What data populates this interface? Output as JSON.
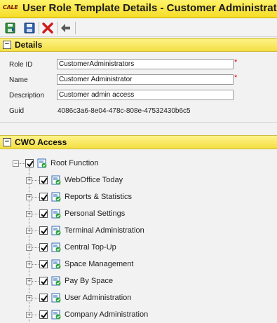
{
  "window": {
    "logo_text": "CALE",
    "title": "User Role Template Details - Customer Administrator"
  },
  "toolbar": {
    "buttons": [
      {
        "name": "save-close",
        "icon": "save-close-icon"
      },
      {
        "name": "save",
        "icon": "floppy-disk-icon"
      },
      {
        "name": "delete",
        "icon": "red-x-icon"
      },
      {
        "name": "back",
        "icon": "back-arrow-icon"
      }
    ]
  },
  "details": {
    "title": "Details",
    "collapse_symbol": "−",
    "fields": {
      "role_id": {
        "label": "Role ID",
        "value": "CustomerAdministrators",
        "required": "*"
      },
      "name": {
        "label": "Name",
        "value": "Customer Administrator",
        "required": "*"
      },
      "description": {
        "label": "Description",
        "value": "Customer admin access"
      },
      "guid": {
        "label": "Guid",
        "value": "4086c3a6-8e04-478c-808e-47532430b6c5"
      }
    }
  },
  "cwo_access": {
    "title": "CWO Access",
    "collapse_symbol": "−",
    "root": {
      "label": "Root Function",
      "checked": true,
      "expanded": true,
      "expander": "−"
    },
    "children": [
      {
        "label": "WebOffice Today",
        "checked": true,
        "expander": "+"
      },
      {
        "label": "Reports & Statistics",
        "checked": true,
        "expander": "+"
      },
      {
        "label": "Personal Settings",
        "checked": true,
        "expander": "+"
      },
      {
        "label": "Terminal Administration",
        "checked": true,
        "expander": "+"
      },
      {
        "label": "Central Top-Up",
        "checked": true,
        "expander": "+"
      },
      {
        "label": "Space Management",
        "checked": true,
        "expander": "+"
      },
      {
        "label": "Pay By Space",
        "checked": true,
        "expander": "+"
      },
      {
        "label": "User Administration",
        "checked": true,
        "expander": "+"
      },
      {
        "label": "Company Administration",
        "checked": true,
        "expander": "+"
      }
    ]
  },
  "colors": {
    "header_yellow": "#f6dc27",
    "required_red": "#e00000"
  }
}
